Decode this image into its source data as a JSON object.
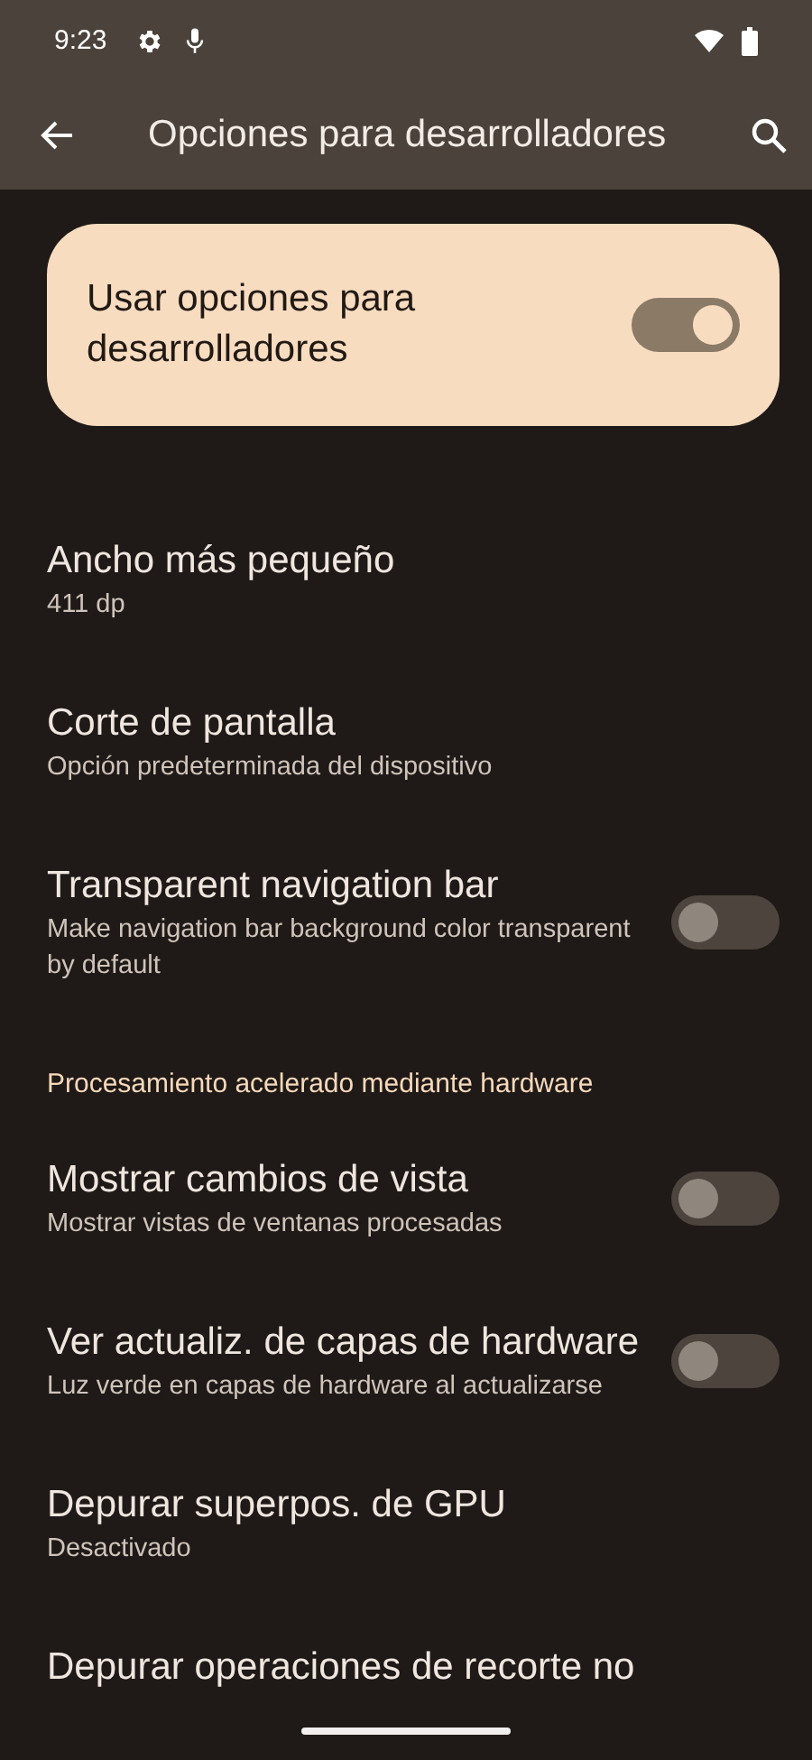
{
  "status_bar": {
    "time": "9:23"
  },
  "app_bar": {
    "title": "Opciones para desarrolladores"
  },
  "main_switch": {
    "label": "Usar opciones para desarrolladores",
    "on": true
  },
  "items": [
    {
      "kind": "nav",
      "title": "Ancho más pequeño",
      "summary": "411 dp"
    },
    {
      "kind": "nav",
      "title": "Corte de pantalla",
      "summary": "Opción predeterminada del dispositivo"
    },
    {
      "kind": "switch",
      "title": "Transparent navigation bar",
      "summary": "Make navigation bar background color transparent by default",
      "on": false
    },
    {
      "kind": "header",
      "title": "Procesamiento acelerado mediante hardware"
    },
    {
      "kind": "switch",
      "title": "Mostrar cambios de vista",
      "summary": "Mostrar vistas de ventanas procesadas",
      "on": false
    },
    {
      "kind": "switch",
      "title": "Ver actualiz. de capas de hardware",
      "summary": "Luz verde en capas de hardware al actualizarse",
      "on": false
    },
    {
      "kind": "nav",
      "title": "Depurar superpos. de GPU",
      "summary": "Desactivado"
    },
    {
      "kind": "nav",
      "title": "Depurar operaciones de recorte no"
    }
  ]
}
